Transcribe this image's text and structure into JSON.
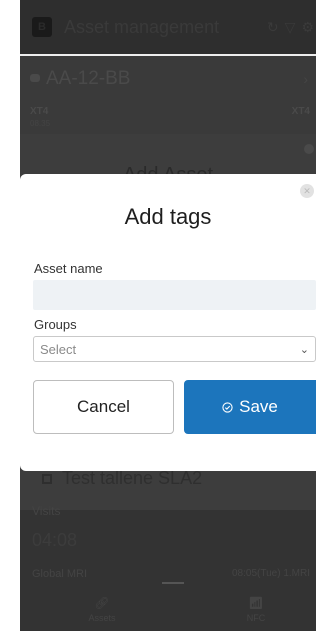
{
  "background": {
    "app_title": "Asset management",
    "logo_text": "B",
    "vehicle": {
      "plate": "AA-12-BB",
      "model": "XT4",
      "model_right": "XT4",
      "sub": "08.35"
    },
    "panel_title": "Add Asset",
    "asset_name_bottom": "Test tallene SLA2",
    "list_label": "Visits",
    "time": "04:08",
    "row_left": "Global MRI",
    "row_right": "08:05(Tue) 1.MRI",
    "nav": {
      "assets_label": "Assets",
      "nfc_label": "NFC"
    }
  },
  "modal": {
    "title": "Add  tags",
    "asset_name_label": "Asset name",
    "asset_name_value": "",
    "groups_label": "Groups",
    "groups_selected": "Select",
    "cancel_label": "Cancel",
    "save_label": "Save"
  },
  "colors": {
    "accent": "#1c75bc",
    "input_bg": "#eef2f5",
    "overlay": "#3d3d3d"
  }
}
